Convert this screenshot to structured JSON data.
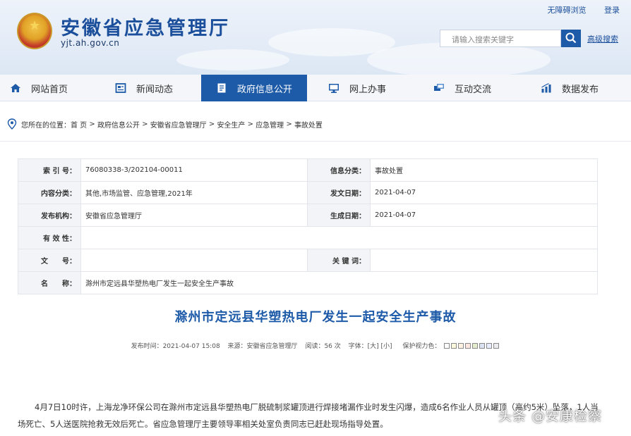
{
  "header": {
    "site_title": "安徽省应急管理厅",
    "site_url": "yjt.ah.gov.cn",
    "top_links": [
      "无障碍浏览",
      "登录"
    ],
    "search_placeholder": "请输入搜索关键字",
    "advanced_search": "高级搜索"
  },
  "nav": {
    "items": [
      {
        "label": "网站首页",
        "icon": "home-icon"
      },
      {
        "label": "新闻动态",
        "icon": "news-icon"
      },
      {
        "label": "政府信息公开",
        "icon": "document-icon",
        "active": true
      },
      {
        "label": "网上办事",
        "icon": "monitor-icon"
      },
      {
        "label": "互动交流",
        "icon": "chat-icon"
      },
      {
        "label": "数据发布",
        "icon": "chart-icon"
      }
    ]
  },
  "breadcrumb": {
    "prefix": "您所在的位置：",
    "path": [
      "首 页",
      "政府信息公开",
      "安徽省应急管理厅",
      "安全生产",
      "应急管理",
      "事故处置"
    ]
  },
  "info": {
    "index_label": "索 引 号：",
    "index_value": "76080338-3/202104-00011",
    "category_label": "信息分类：",
    "category_value": "事故处置",
    "content_label": "内容分类：",
    "content_value": "其他,市场监管、应急管理,2021年",
    "issue_date_label": "发文日期：",
    "issue_date_value": "2021-04-07",
    "publisher_label": "发布机构：",
    "publisher_value": "安徽省应急管理厅",
    "created_label": "生成日期：",
    "created_value": "2021-04-07",
    "validity_label": "有 效 性：",
    "validity_value": "",
    "docno_label": "文　　号：",
    "docno_value": "",
    "keywords_label": "关 键 词：",
    "keywords_value": "",
    "name_label": "名　　称：",
    "name_value": "滁州市定远县华塑热电厂发生一起安全生产事故"
  },
  "article": {
    "title": "滁州市定远县华塑热电厂发生一起安全生产事故",
    "meta_time": "发布时间：2021-04-07 15:08",
    "meta_source": "来源：安徽省应急管理厅",
    "meta_views": "阅读：56 次",
    "meta_font": "字体：[大] [小]",
    "meta_eye": "保护视力色：",
    "body": "4月7日10时许，上海龙净环保公司在滁州市定远县华塑热电厂脱硫制浆罐顶进行焊接堵漏作业时发生闪爆，造成6名作业人员从罐顶（高约5米）坠落，1人当场死亡、5人送医院抢救无效后死亡。省应急管理厅主要领导率相关处室负责同志已赶赴现场指导处置。"
  },
  "watermark": "头条 @安康检察",
  "colors": {
    "brand_blue": "#1d5aa8",
    "title_blue": "#1b4e9b"
  }
}
